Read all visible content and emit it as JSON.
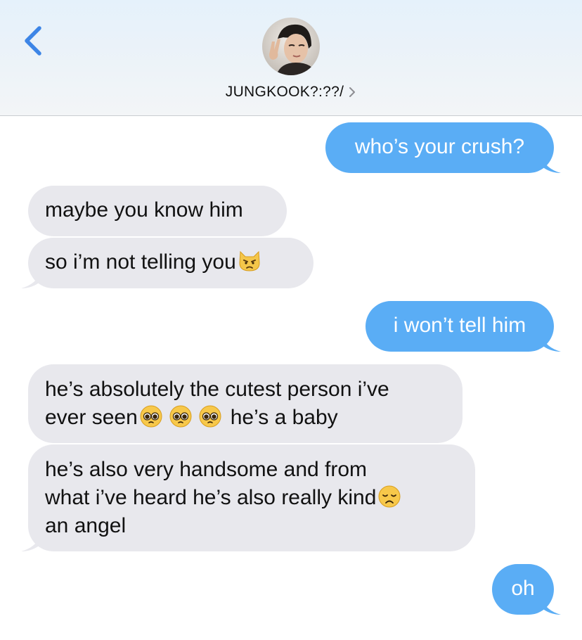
{
  "header": {
    "contact_name": "JUNGKOOK?:??/",
    "colors": {
      "accent": "#3d85e6",
      "header_bg": "#eaf2fa"
    }
  },
  "icons": {
    "back": "chevron-left-icon",
    "contact_detail": "chevron-right-icon",
    "avatar": "contact-avatar"
  },
  "messages": [
    {
      "direction": "outgoing",
      "text": "who’s your crush?"
    },
    {
      "direction": "incoming",
      "text": "maybe you know him"
    },
    {
      "direction": "incoming",
      "text": "so i’m not telling you",
      "emoji": "pouting-cat-emoji"
    },
    {
      "direction": "outgoing",
      "text": "i won’t tell him"
    },
    {
      "direction": "incoming",
      "line1": "he’s absolutely the cutest person i’ve",
      "line2a": "ever seen",
      "line2b": "he’s a baby",
      "emoji": "pleading-face-emoji"
    },
    {
      "direction": "incoming",
      "line1": "he’s also very handsome and from",
      "line2": "what i’ve heard he’s also really kind",
      "line3": "an angel",
      "emoji": "disappointed-face-emoji"
    },
    {
      "direction": "outgoing",
      "text": "oh"
    }
  ],
  "colors": {
    "outgoing_bubble": "#5aadf5",
    "incoming_bubble": "#e8e8ed"
  }
}
